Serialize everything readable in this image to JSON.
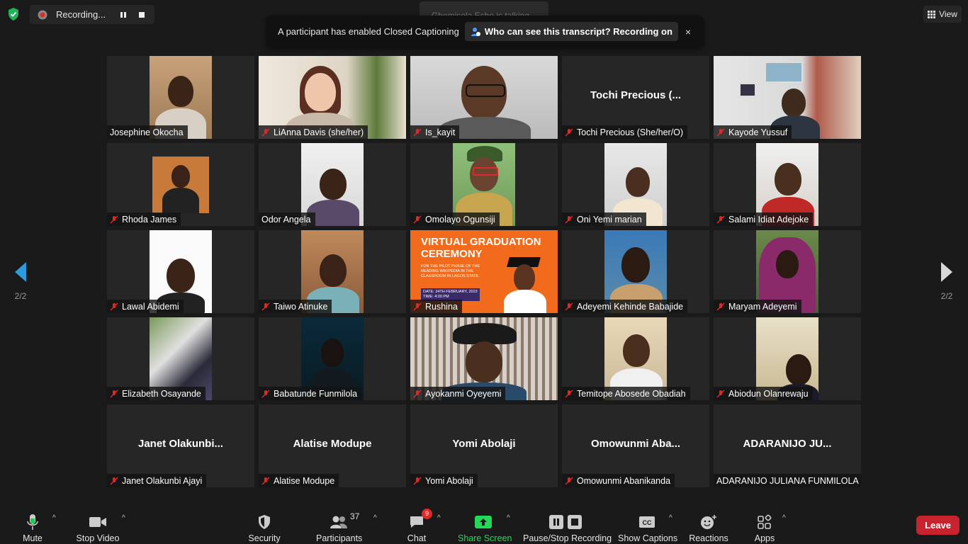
{
  "top": {
    "recording_label": "Recording...",
    "talking_label": "Gbemisola Esho is talking...",
    "view_label": "View"
  },
  "banner": {
    "text": "A participant has enabled Closed Captioning",
    "link": "Who can see this transcript? Recording on",
    "close": "×"
  },
  "grid": {
    "r1": [
      "Josephine Okocha",
      "LiAnna Davis (she/her)",
      "Is_kayit",
      "Tochi Precious (She/her/O)",
      "Kayode Yussuf"
    ],
    "r2": [
      "Rhoda James",
      "Odor Angela",
      "Omolayo Ogunsiji",
      "Oni Yemi marian",
      "Salami Idiat Adejoke"
    ],
    "r3": [
      "Lawal Abidemi",
      "Taiwo Atinuke",
      "Rushina",
      "Adeyemi Kehinde Babajide",
      "Maryam Adeyemi"
    ],
    "r4": [
      "Elizabeth Osayande",
      "Babatunde Funmilola",
      "Ayokanmi Oyeyemi",
      "Temitope Abosede Obadiah",
      "Abiodun Olanrewaju"
    ],
    "r5": [
      "Janet Olakunbi Ajayi",
      "Alatise Modupe",
      "Yomi Abolaji",
      "Omowunmi Abanikanda",
      "ADARANIJO JULIANA  FUNMILOLA"
    ],
    "display": {
      "tochi": "Tochi  Precious  (...",
      "janet": "Janet  Olakunbi...",
      "alatise": "Alatise Modupe",
      "yomi": "Yomi Abolaji",
      "omowunmi": "Omowunmi  Aba...",
      "adaranijo": "ADARANIJO JU..."
    }
  },
  "poster": {
    "title": "VIRTUAL GRADUATION CEREMONY",
    "subtitle": "FOR THE PILOT PHASE OF THE READING WIKIPEDIA IN THE CLASSROOM IN LAGOS STATE.",
    "date": "DATE: 24TH FEBRUARY, 2023",
    "time": "TIME: 4:00 PM"
  },
  "pagination": {
    "left": "2/2",
    "right": "2/2"
  },
  "toolbar": {
    "mute": "Mute",
    "stop_video": "Stop Video",
    "security": "Security",
    "participants": "Participants",
    "participants_count": "37",
    "chat": "Chat",
    "chat_badge": "9",
    "share_screen": "Share Screen",
    "pause_recording": "Pause/Stop Recording",
    "show_captions": "Show Captions",
    "reactions": "Reactions",
    "apps": "Apps",
    "leave": "Leave"
  },
  "colors": {
    "share_green": "#23d959",
    "leave_red": "#c6232f",
    "poster_orange": "#f26b1d",
    "mute_red": "#e02828"
  }
}
